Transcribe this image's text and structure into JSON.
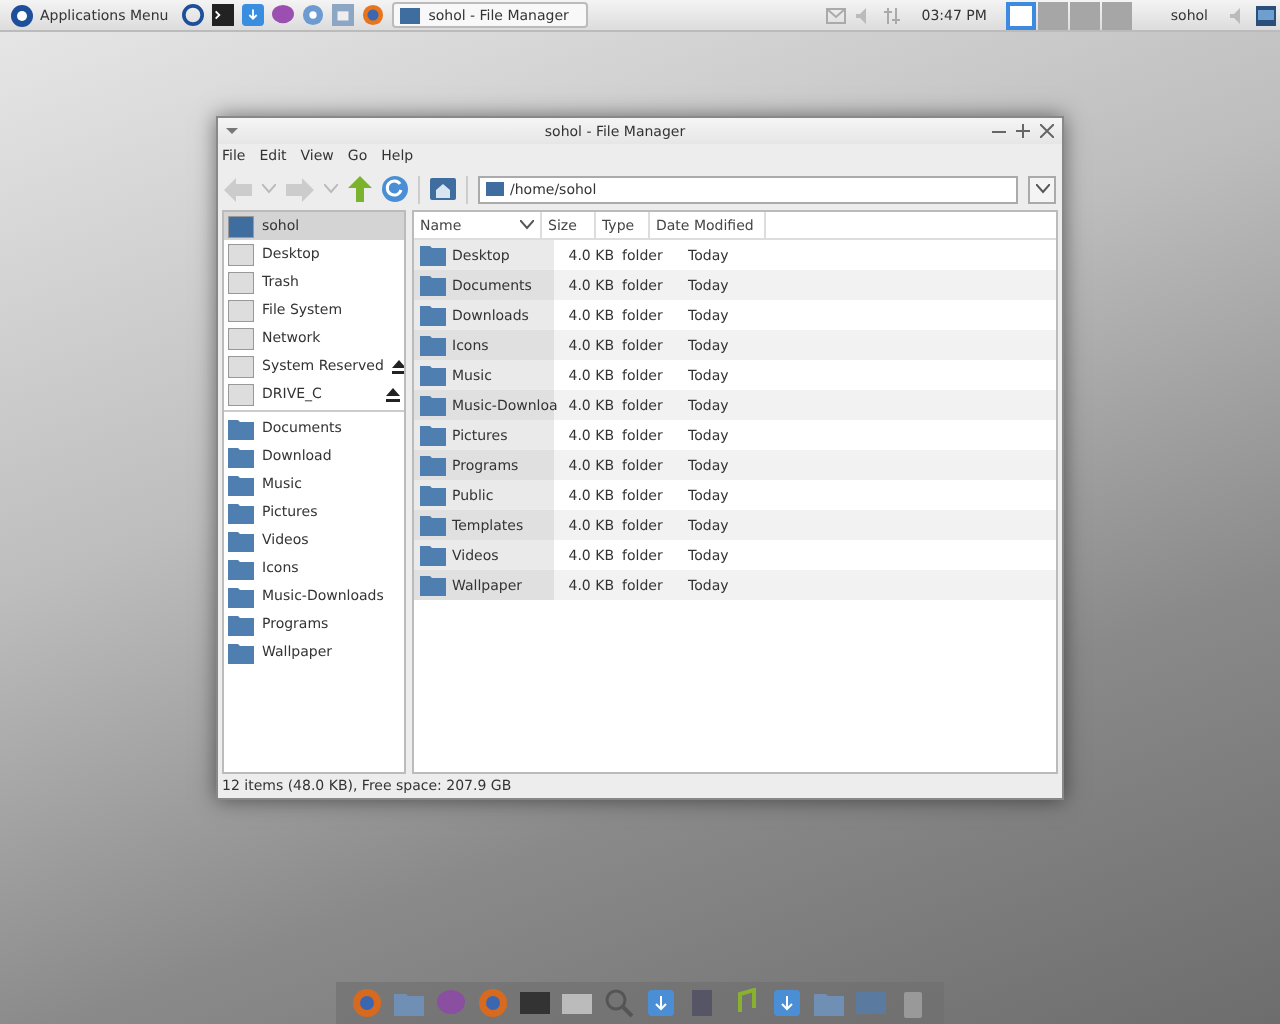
{
  "top_panel": {
    "app_menu": "Applications Menu",
    "task": "sohol - File Manager",
    "clock": "03:47 PM",
    "workspaces": [
      {
        "selected": true
      },
      {
        "selected": false
      },
      {
        "selected": false
      },
      {
        "selected": false
      }
    ],
    "user": "sohol"
  },
  "window": {
    "title": "sohol - File Manager",
    "menu": [
      "File",
      "Edit",
      "View",
      "Go",
      "Help"
    ],
    "location": "/home/sohol"
  },
  "sidebar": {
    "devices": [
      {
        "label": "sohol",
        "selected": true,
        "ejectable": false
      },
      {
        "label": "Desktop",
        "selected": false,
        "ejectable": false
      },
      {
        "label": "Trash",
        "selected": false,
        "ejectable": false
      },
      {
        "label": "File System",
        "selected": false,
        "ejectable": false
      },
      {
        "label": "Network",
        "selected": false,
        "ejectable": false
      },
      {
        "label": "System Reserved",
        "selected": false,
        "ejectable": true
      },
      {
        "label": "DRIVE_C",
        "selected": false,
        "ejectable": true
      }
    ],
    "bookmarks": [
      "Documents",
      "Download",
      "Music",
      "Pictures",
      "Videos",
      "Icons",
      "Music-Downloads",
      "Programs",
      "Wallpaper"
    ]
  },
  "table": {
    "columns": [
      "Name",
      "Size",
      "Type",
      "Date Modified"
    ],
    "rows": [
      [
        "Desktop",
        "4.0 KB",
        "folder",
        "Today"
      ],
      [
        "Documents",
        "4.0 KB",
        "folder",
        "Today"
      ],
      [
        "Downloads",
        "4.0 KB",
        "folder",
        "Today"
      ],
      [
        "Icons",
        "4.0 KB",
        "folder",
        "Today"
      ],
      [
        "Music",
        "4.0 KB",
        "folder",
        "Today"
      ],
      [
        "Music-Downloa",
        "4.0 KB",
        "folder",
        "Today"
      ],
      [
        "Pictures",
        "4.0 KB",
        "folder",
        "Today"
      ],
      [
        "Programs",
        "4.0 KB",
        "folder",
        "Today"
      ],
      [
        "Public",
        "4.0 KB",
        "folder",
        "Today"
      ],
      [
        "Templates",
        "4.0 KB",
        "folder",
        "Today"
      ],
      [
        "Videos",
        "4.0 KB",
        "folder",
        "Today"
      ],
      [
        "Wallpaper",
        "4.0 KB",
        "folder",
        "Today"
      ]
    ]
  },
  "status_bar": "12 items (48.0 KB), Free space: 207.9 GB"
}
